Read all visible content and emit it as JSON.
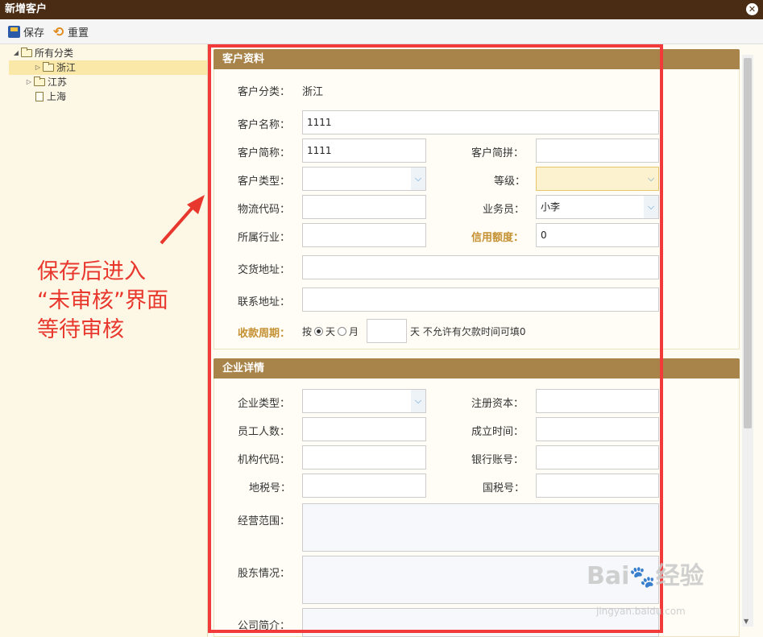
{
  "window": {
    "title": "新增客户"
  },
  "toolbar": {
    "save_label": "保存",
    "reset_label": "重置"
  },
  "tree": {
    "root": "所有分类",
    "items": [
      "浙江",
      "江苏",
      "上海"
    ]
  },
  "annotation": {
    "line1": "保存后进入",
    "line2": "“未审核”界面",
    "line3": "等待审核"
  },
  "customer": {
    "section_title": "客户资料",
    "category_label": "客户分类：",
    "category_value": "浙江",
    "name_label": "客户名称：",
    "name_value": "1111",
    "short_label": "客户简称：",
    "short_value": "1111",
    "pinyin_label": "客户简拼：",
    "type_label": "客户类型：",
    "level_label": "等级：",
    "logistics_label": "物流代码：",
    "salesman_label": "业务员：",
    "salesman_value": "小李",
    "industry_label": "所属行业：",
    "credit_label": "信用额度：",
    "credit_value": "0",
    "delivery_label": "交货地址：",
    "contact_label": "联系地址：",
    "period_label": "收款周期：",
    "period_by": "按",
    "period_day": "天",
    "period_month": "月",
    "period_hint": "天 不允许有欠款时间可填0"
  },
  "enterprise": {
    "section_title": "企业详情",
    "type_label": "企业类型：",
    "capital_label": "注册资本：",
    "staff_label": "员工人数：",
    "founded_label": "成立时间：",
    "org_label": "机构代码：",
    "bank_label": "银行账号：",
    "local_tax_label": "地税号：",
    "national_tax_label": "国税号：",
    "scope_label": "经营范围：",
    "shareholder_label": "股东情况：",
    "intro_label": "公司简介："
  },
  "watermark": {
    "brand": "Bai",
    "brand2": "经验",
    "url": "jingyan.baidu.com"
  },
  "colors": {
    "titlebar": "#4a2c14",
    "section": "#a8844a",
    "highlight": "#c49032",
    "annotation": "#e8382e",
    "redbox": "#f23a3a"
  }
}
